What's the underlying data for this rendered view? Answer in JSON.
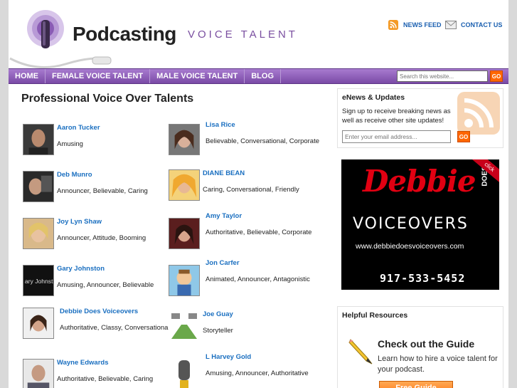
{
  "header": {
    "logo_word": "Podcasting",
    "logo_tag": "VOICE TALENT",
    "news_feed": "NEWS FEED",
    "contact_us": "CONTACT US"
  },
  "nav": {
    "items": [
      "HOME",
      "FEMALE VOICE TALENT",
      "MALE VOICE TALENT",
      "BLOG"
    ],
    "search_placeholder": "Search this website...",
    "go_label": "GO"
  },
  "main": {
    "title": "Professional Voice Over Talents",
    "talents": [
      {
        "name": "Aaron Tucker",
        "tags": "Amusing"
      },
      {
        "name": "Lisa Rice",
        "tags": "Believable, Conversational, Corporate"
      },
      {
        "name": "Deb Munro",
        "tags": "Announcer, Believable, Caring"
      },
      {
        "name": "DIANE BEAN",
        "tags": "Caring, Conversational, Friendly"
      },
      {
        "name": "Joy Lyn Shaw",
        "tags": "Announcer, Attitude, Booming"
      },
      {
        "name": "Amy Taylor",
        "tags": "Authoritative, Believable, Corporate"
      },
      {
        "name": "Gary Johnston",
        "tags": "Amusing, Announcer, Believable"
      },
      {
        "name": "Jon Carfer",
        "tags": "Animated, Announcer, Antagonistic"
      },
      {
        "name": "Debbie Does Voiceovers",
        "tags": "Authoritative, Classy, Conversational"
      },
      {
        "name": "Joe Guay",
        "tags": "Storyteller"
      },
      {
        "name": "Wayne Edwards",
        "tags": "Authoritative, Believable, Caring"
      },
      {
        "name": "L Harvey Gold",
        "tags": "Amusing, Announcer, Authoritative"
      }
    ]
  },
  "sidebar": {
    "enews_title": "eNews & Updates",
    "enews_text": "Sign up to receive breaking news as well as receive other site updates!",
    "email_placeholder": "Enter your email address...",
    "go_label": "GO",
    "ad": {
      "script": "Debbie",
      "does": "DOES",
      "vo": "VOICEOVERS",
      "url": "www.debbiedoesvoiceovers.com",
      "phone": "917-533-5452",
      "corner": "click"
    },
    "resources_title": "Helpful Resources",
    "guide_title": "Check out the Guide",
    "guide_text": "Learn how to hire a voice talent for your podcast.",
    "guide_button": "Free Guide"
  },
  "colors": {
    "nav_purple": "#8a5cb5",
    "accent_orange": "#ff6600",
    "link_blue": "#1a6fc0",
    "ad_red": "#e10012"
  }
}
